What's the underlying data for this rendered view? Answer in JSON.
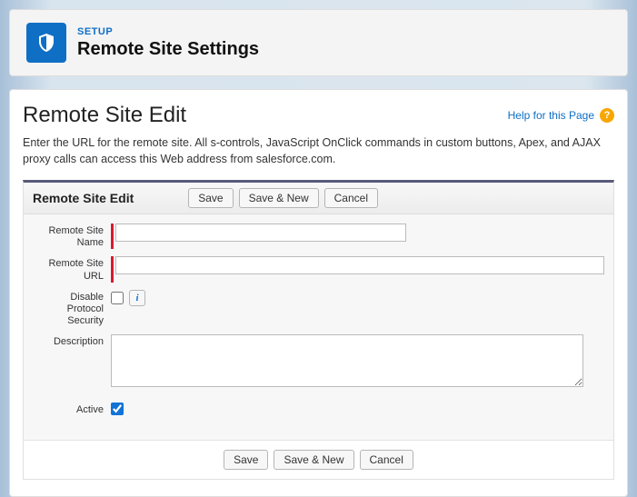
{
  "header": {
    "overline": "SETUP",
    "title": "Remote Site Settings"
  },
  "page": {
    "title": "Remote Site Edit",
    "help_link": "Help for this Page",
    "intro": "Enter the URL for the remote site. All s-controls, JavaScript OnClick commands in custom buttons, Apex, and AJAX proxy calls can access this Web address from salesforce.com."
  },
  "panel": {
    "section_title": "Remote Site Edit",
    "buttons": {
      "save": "Save",
      "save_new": "Save & New",
      "cancel": "Cancel"
    }
  },
  "form": {
    "labels": {
      "name": "Remote Site Name",
      "url": "Remote Site URL",
      "disable": "Disable Protocol Security",
      "description": "Description",
      "active": "Active"
    },
    "values": {
      "name": "",
      "url": "",
      "disable_protocol_security": false,
      "description": "",
      "active": true
    },
    "info_tooltip": "i"
  }
}
